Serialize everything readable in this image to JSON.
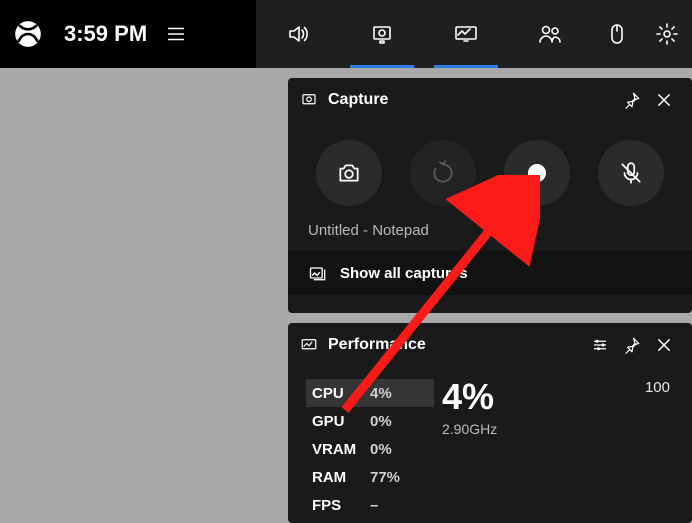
{
  "topbar": {
    "time": "3:59 PM"
  },
  "capture": {
    "title": "Capture",
    "subtitle": "Untitled - Notepad",
    "show_all": "Show all captures"
  },
  "performance": {
    "title": "Performance",
    "stats": {
      "cpu_label": "CPU",
      "cpu_val": "4%",
      "gpu_label": "GPU",
      "gpu_val": "0%",
      "vram_label": "VRAM",
      "vram_val": "0%",
      "ram_label": "RAM",
      "ram_val": "77%",
      "fps_label": "FPS",
      "fps_val": "–"
    },
    "big_value": "4%",
    "sub_value": "2.90GHz",
    "right_value": "100"
  }
}
